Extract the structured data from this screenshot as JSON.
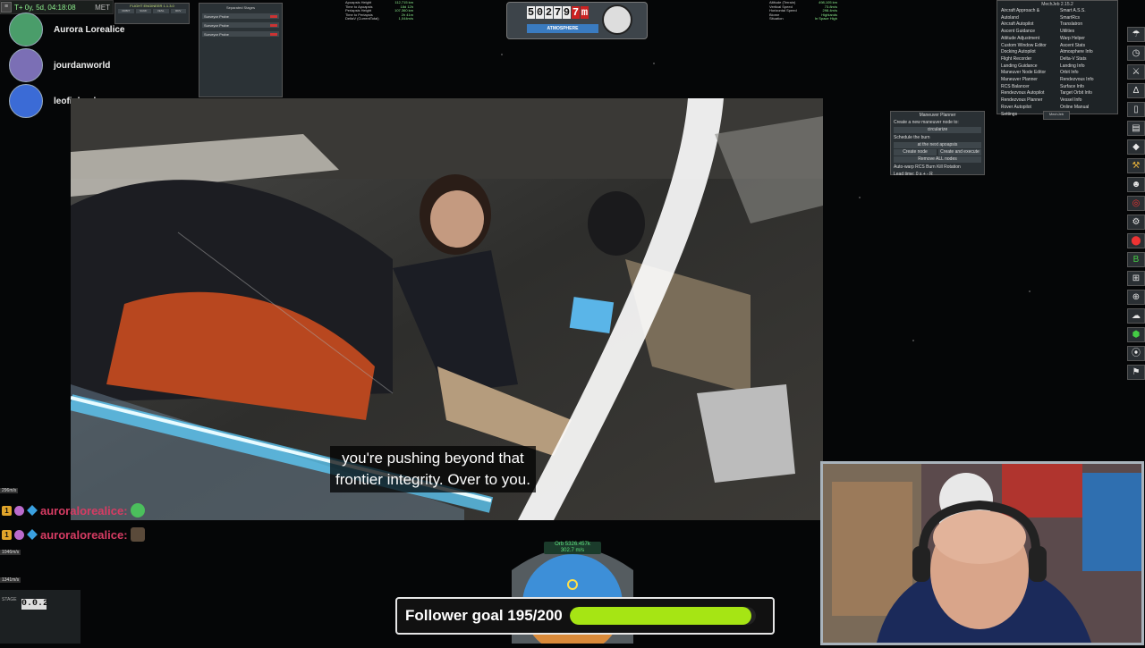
{
  "hud": {
    "met_text": "T+ 0y, 5d, 04:18:08",
    "met_label": "MET",
    "fe_title": "FLIGHT ENGINEER 1.1.3.0",
    "fe_buttons": [
      "ORBIT",
      "SURF",
      "VESL",
      "RDV"
    ],
    "stages_title": "Separated Stages",
    "stages_rows": [
      "Surveyor Probe",
      "Surveyor Probe",
      "Surveyor Probe"
    ],
    "orbit_info": [
      {
        "label": "Apoapsis Height",
        "value": "112,715 km"
      },
      {
        "label": "Time to Apoapsis",
        "value": "18d 12h"
      },
      {
        "label": "Periapsis Height",
        "value": "107,360 km"
      },
      {
        "label": "Time to Periapsis",
        "value": "2h 41m"
      },
      {
        "label": "DeltaV (CurrentTotal)",
        "value": "1,044m/s"
      }
    ],
    "vessel_info": [
      {
        "label": "Altitude (Terrain)",
        "value": "498,105 km"
      },
      {
        "label": "Vertical Speed",
        "value": "73.8m/s"
      },
      {
        "label": "Horizontal Speed",
        "value": "298.4m/s"
      },
      {
        "label": "Biome",
        "value": "Highlands"
      },
      {
        "label": "Situation",
        "value": "In Space High"
      }
    ],
    "altimeter_digits": [
      "5",
      "0",
      "2",
      "7",
      "9",
      "7",
      "m"
    ],
    "altimeter_red_index": 5,
    "atmosphere_label": "ATMOSPHERE"
  },
  "viewers": [
    {
      "name": "Aurora Lorealice",
      "color": "#4a9d6a"
    },
    {
      "name": "jourdanworld",
      "color": "#7b6fb5"
    },
    {
      "name": "leofinlarel",
      "color": "#3b6bd6"
    }
  ],
  "mechjeb": {
    "title": "MechJeb 2.15.2",
    "col1": [
      "Aircraft Approach & Autoland",
      "Aircraft Autopilot",
      "Ascent Guidance",
      "Attitude Adjustment",
      "Custom Window Editor",
      "Docking Autopilot",
      "Flight Recorder",
      "Landing Guidance",
      "Maneuver Node Editor",
      "Maneuver Planner",
      "RCS Balancer",
      "Rendezvous Autopilot",
      "Rendezvous Planner",
      "Rover Autopilot",
      "Settings"
    ],
    "col2": [
      "Smart A.S.S.",
      "SmartRcs",
      "Translatron",
      "Utilities",
      "Warp Helper",
      "Ascent Stats",
      "Atmosphere Info",
      "Delta-V Stats",
      "Landing Info",
      "Orbit Info",
      "Rendezvous Info",
      "Surface Info",
      "Target Orbit Info",
      "Vessel Info",
      "Online Manual"
    ],
    "tab": "MechJeb"
  },
  "maneuver": {
    "title": "Maneuver Planner",
    "line1": "Create a new maneuver node to:",
    "op": "circularize",
    "schedule": "Schedule the burn",
    "timing": "at the next apoapsis",
    "create_node": "Create node",
    "create_execute": "Create and execute",
    "remove_all": "Remove ALL nodes",
    "autowarp": "Auto-warp  RCS Burn  Kill Rotation",
    "lead": "Lead time: 0  s + - R"
  },
  "toolbar_icons": [
    {
      "name": "parachute-icon",
      "glyph": "☂",
      "tone": "white"
    },
    {
      "name": "clock-icon",
      "glyph": "◷",
      "tone": "white"
    },
    {
      "name": "antenna-icon",
      "glyph": "⚔",
      "tone": "white"
    },
    {
      "name": "delta-v-icon",
      "glyph": "Δ",
      "tone": "white"
    },
    {
      "name": "document-icon",
      "glyph": "▯",
      "tone": "white"
    },
    {
      "name": "book-icon",
      "glyph": "▤",
      "tone": "white"
    },
    {
      "name": "diamond-icon",
      "glyph": "◆",
      "tone": "white"
    },
    {
      "name": "wrench-icon",
      "glyph": "⚒",
      "tone": "gold"
    },
    {
      "name": "kerbal-icon",
      "glyph": "☻",
      "tone": "white"
    },
    {
      "name": "target-icon",
      "glyph": "◎",
      "tone": "red"
    },
    {
      "name": "gear-icon",
      "glyph": "⚙",
      "tone": "white"
    },
    {
      "name": "pin-icon",
      "glyph": "⬤",
      "tone": "red"
    },
    {
      "name": "battery-icon",
      "glyph": "B",
      "tone": "green"
    },
    {
      "name": "map-icon",
      "glyph": "⊞",
      "tone": "white"
    },
    {
      "name": "crosshair-icon",
      "glyph": "⊕",
      "tone": "white"
    },
    {
      "name": "cloud-icon",
      "glyph": "☁",
      "tone": "white"
    },
    {
      "name": "cube-icon",
      "glyph": "⬢",
      "tone": "green"
    },
    {
      "name": "camera-icon",
      "glyph": "⦿",
      "tone": "white"
    },
    {
      "name": "flag-icon",
      "glyph": "⚑",
      "tone": "white"
    }
  ],
  "subtitle": {
    "line1": "you're pushing beyond that",
    "line2": "frontier integrity. Over to you."
  },
  "chat": [
    {
      "user": "auroralorealice:",
      "badge": "1"
    },
    {
      "user": "auroralorealice:",
      "badge": "1"
    }
  ],
  "speed_tags": [
    "296m/s",
    "1046m/s",
    "1341m/s"
  ],
  "stage": {
    "label": "STAGE",
    "value": "0.0.2"
  },
  "navball": {
    "mode": "Orb 5326.457k",
    "speed": "302.7 m/s",
    "heading": "090°"
  },
  "follower_goal": {
    "label": "Follower goal 195/200",
    "current": 195,
    "target": 200,
    "bar_color": "#a6e514"
  }
}
